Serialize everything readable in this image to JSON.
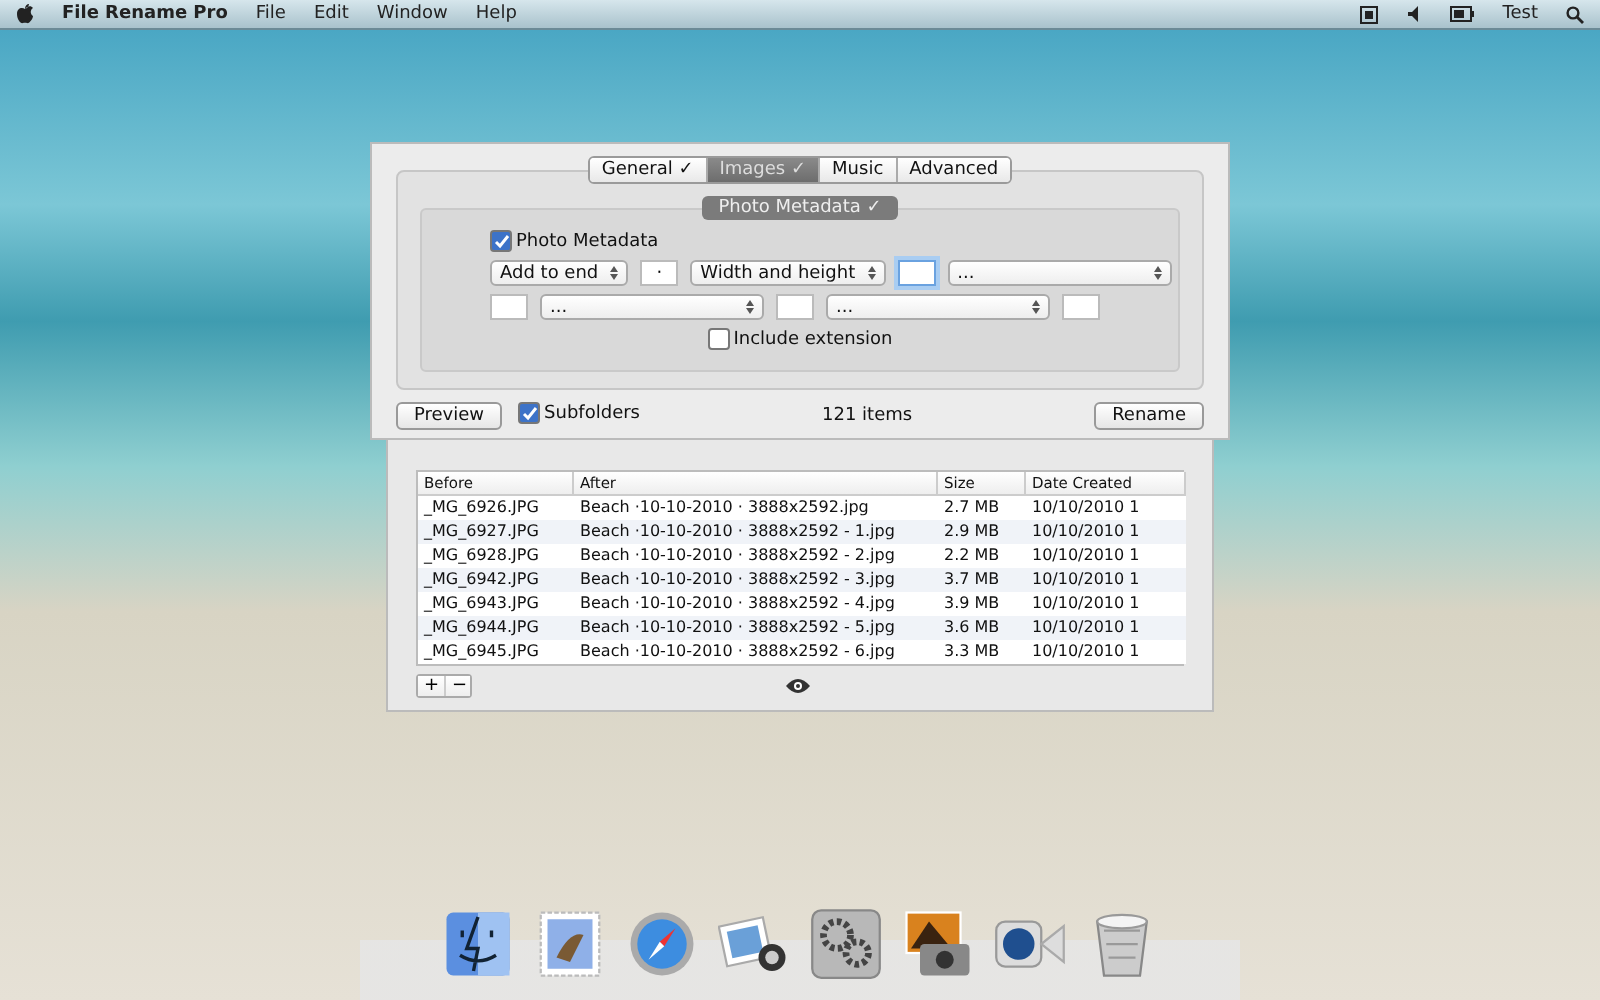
{
  "menu_bar": {
    "app_name": "File Rename Pro",
    "items": [
      "File",
      "Edit",
      "Window",
      "Help"
    ],
    "user": "Test"
  },
  "tabs": [
    {
      "label": "General ✓",
      "selected": false
    },
    {
      "label": "Images ✓",
      "selected": true
    },
    {
      "label": "Music",
      "selected": false
    },
    {
      "label": "Advanced",
      "selected": false
    }
  ],
  "group": {
    "title": "Photo Metadata ✓",
    "checkbox": {
      "label": "Photo Metadata",
      "checked": true
    },
    "row_1": [
      {
        "kind": "select",
        "value": "Add to end"
      },
      {
        "kind": "field",
        "value": "·",
        "focused": false
      },
      {
        "kind": "select",
        "value": "Width and height"
      },
      {
        "kind": "field",
        "focused": true
      },
      {
        "kind": "menu",
        "value": "..."
      }
    ],
    "row_2": [
      {
        "kind": "field",
        "focused": false
      },
      {
        "kind": "menu",
        "value": "..."
      },
      {
        "kind": "field",
        "focused": false
      },
      {
        "kind": "menu",
        "value": "..."
      },
      {
        "kind": "field",
        "focused": false
      }
    ],
    "include_extension": {
      "label": "Include extension",
      "checked": false
    }
  },
  "footer": {
    "preview": "Preview",
    "subfolders": {
      "label": "Subfolders",
      "checked": true
    },
    "count": "121 items",
    "rename": "Rename"
  },
  "table": {
    "columns": [
      "Before",
      "After",
      "Size",
      "Date Created"
    ],
    "rows": [
      [
        "_MG_6926.JPG",
        "Beach ·10-10-2010  · 3888x2592.jpg",
        "2.7 MB",
        "10/10/2010 1"
      ],
      [
        "_MG_6927.JPG",
        "Beach ·10-10-2010  · 3888x2592 - 1.jpg",
        "2.9 MB",
        "10/10/2010 1"
      ],
      [
        "_MG_6928.JPG",
        "Beach ·10-10-2010  · 3888x2592 - 2.jpg",
        "2.2 MB",
        "10/10/2010 1"
      ],
      [
        "_MG_6942.JPG",
        "Beach ·10-10-2010  · 3888x2592 - 3.jpg",
        "3.7 MB",
        "10/10/2010 1"
      ],
      [
        "_MG_6943.JPG",
        "Beach ·10-10-2010  · 3888x2592 - 4.jpg",
        "3.9 MB",
        "10/10/2010 1"
      ],
      [
        "_MG_6944.JPG",
        "Beach ·10-10-2010  · 3888x2592 - 5.jpg",
        "3.6 MB",
        "10/10/2010 1"
      ],
      [
        "_MG_6945.JPG",
        "Beach ·10-10-2010  · 3888x2592 - 6.jpg",
        "3.3 MB",
        "10/10/2010 1"
      ]
    ]
  },
  "table_buttons": [
    "+",
    "−"
  ]
}
